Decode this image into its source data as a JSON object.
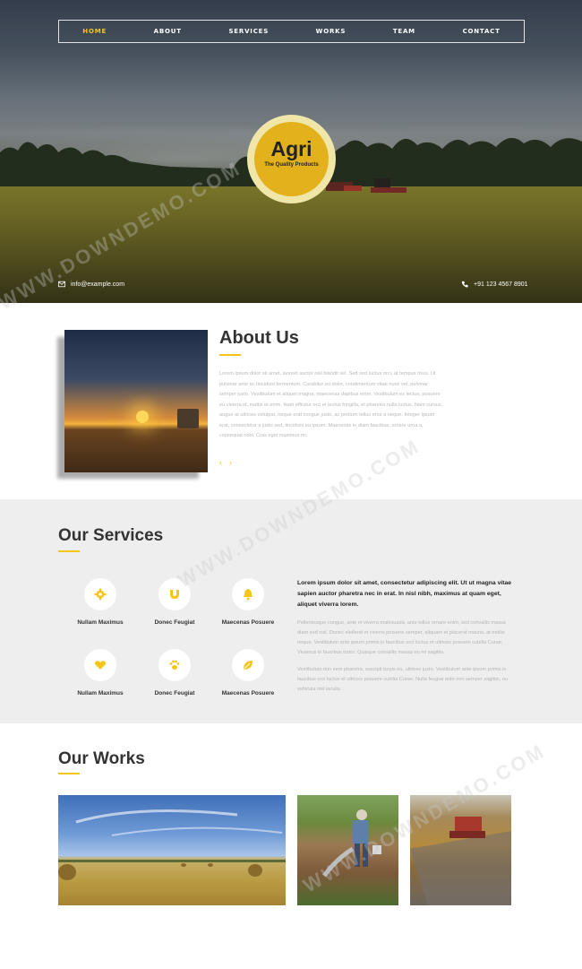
{
  "nav": {
    "items": [
      {
        "label": "HOME",
        "active": true
      },
      {
        "label": "ABOUT",
        "active": false
      },
      {
        "label": "SERVICES",
        "active": false
      },
      {
        "label": "WORKS",
        "active": false
      },
      {
        "label": "TEAM",
        "active": false
      },
      {
        "label": "CONTACT",
        "active": false
      }
    ]
  },
  "logo": {
    "name": "Agri",
    "tagline": "The Quality Products"
  },
  "contact": {
    "email": "info@example.com",
    "phone": "+91 123 4567 8901",
    "email_icon": "mail-icon",
    "phone_icon": "phone-icon"
  },
  "about": {
    "title": "About Us",
    "text": "Lorem ipsum dolor sit amet, laoreet auctor nisl blandit vel. Sed sed luctus orci, at tempus risus. Ut pulvinar ante ac tincidunt fermentum. Curabitur eu dolor, condimentum vitae nunc vel, pulvinar semper justo. Vestibulum et aliquet magna, maecenas dapibus enim. Vestibulum ex lectus, posuere eu viverra id, mattis et enim. Nam efficitur orci et lectus fringilla, et pharetra nulla luctus. Nam cursus, augue at ultrices volutpat, neque erat congue justo, ac pretium tellus eros a neque. Integer ipsum erat, consectetur a justo sed, tincidunt eu ipsum. Maecenas in diam faucibus, ornare urna a, consequat odio. Cras eget maximus mi.",
    "prev": "‹",
    "next": "›"
  },
  "services": {
    "title": "Our Services",
    "items": [
      {
        "label": "Nullam Maximus",
        "icon": "gear-icon"
      },
      {
        "label": "Donec Feugiat",
        "icon": "magnet-icon"
      },
      {
        "label": "Maecenas Posuere",
        "icon": "bell-icon"
      },
      {
        "label": "Nullam Maximus",
        "icon": "heart-icon"
      },
      {
        "label": "Donec Feugiat",
        "icon": "paw-icon"
      },
      {
        "label": "Maecenas Posuere",
        "icon": "leaf-icon"
      }
    ],
    "lead": "Lorem ipsum dolor sit amet, consectetur adipiscing elit. Ut ut magna vitae sapien auctor pharetra nec in erat. In nisl nibh, maximus at quam eget, aliquet viverra lorem.",
    "para1": "Pellentesque congue, ante et viverra malesuada, ante tellus ornare enim, sed convallis massa diam sed nisl. Donec eleifend et viverra posuere semper, aliquam et placerat mauris, at mollis neque. Vestibulum ante ipsum primis in faucibus orci luctus et ultrices posuere cubilia Curae; Vivamus in faucibus tortor. Quisque convallis massa eu mi sagittis.",
    "para2": "Vestibulum non sem pharetra, suscipit turpis eu, ultrices justo. Vestibulum ante ipsum primis in faucibus orci luctus et ultrices posuere cubilia Curae; Nulla feugiat ante non semper sagittis, eu vehicula nisl iaculis."
  },
  "works": {
    "title": "Our Works"
  },
  "colors": {
    "accent": "#f5c518",
    "services_bg": "#eeeeee"
  }
}
